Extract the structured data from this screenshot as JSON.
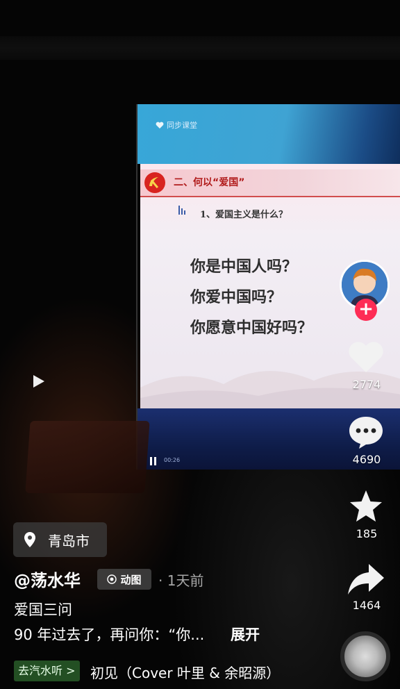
{
  "video": {
    "app_logo_text": "同步课堂",
    "slide_title": "二、何以“爱国”",
    "slide_subheading": "1、爱国主义是什么？",
    "questions": [
      "你是中国人吗？",
      "你爱中国吗？",
      "你愿意中国好吗？"
    ],
    "time_text": "00:26"
  },
  "rail": {
    "follow_symbol": "+",
    "like_count": "2774",
    "comment_count": "4690",
    "favorite_count": "185",
    "share_count": "1464"
  },
  "info": {
    "location": "青岛市",
    "username": "@荡水华",
    "gif_badge": "动图",
    "post_time": "· 1天前",
    "caption_title": "爱国三问",
    "caption_body": "90 年过去了，再问你：“你...",
    "expand_label": "展开",
    "music_tag": "去汽水听 >",
    "music_title": "初见（Cover 叶里 & 余昭源）"
  },
  "colors": {
    "follow_red": "#fe2c55",
    "slide_red": "#b11b1b"
  }
}
